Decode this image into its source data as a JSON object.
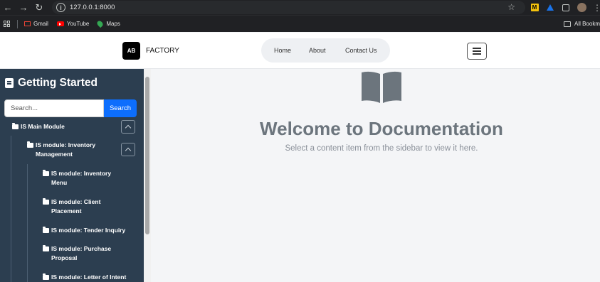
{
  "browser": {
    "url": "127.0.0.1:8000",
    "bookmarks": [
      "Gmail",
      "YouTube",
      "Maps"
    ],
    "all_bookmarks": "All Bookm"
  },
  "header": {
    "logo": "AB",
    "brand": "FACTORY",
    "nav": [
      "Home",
      "About",
      "Contact Us"
    ]
  },
  "sidebar": {
    "title": "Getting Started",
    "search_placeholder": "Search...",
    "search_button": "Search",
    "tree": [
      {
        "label": "IS Main Module",
        "level": 0
      },
      {
        "label": "IS module: Inventory Management",
        "level": 1
      },
      {
        "label": "IS module: Inventory Menu",
        "level": 2
      },
      {
        "label": "IS module: Client Placement",
        "level": 2
      },
      {
        "label": "IS module: Tender Inquiry",
        "level": 2
      },
      {
        "label": "IS module: Purchase Proposal",
        "level": 2
      },
      {
        "label": "IS module: Letter of Intent",
        "level": 2
      }
    ]
  },
  "main": {
    "title": "Welcome to Documentation",
    "subtitle": "Select a content item from the sidebar to view it here."
  },
  "colors": {
    "sidebar_bg": "#2c3e50",
    "primary": "#0d6efd",
    "heading": "#6c757d"
  }
}
